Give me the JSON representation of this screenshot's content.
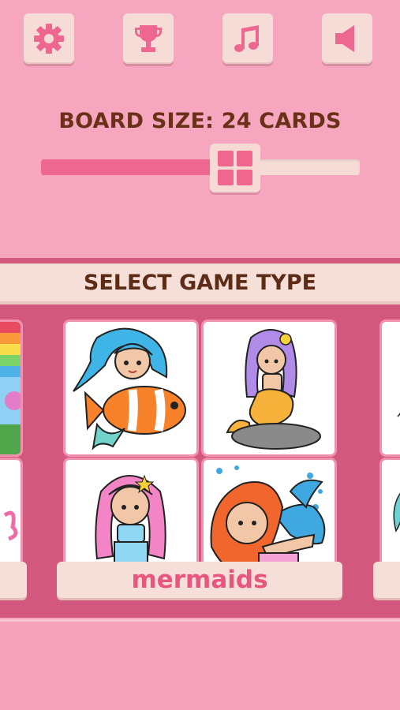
{
  "toolbar": {
    "buttons": [
      {
        "name": "settings",
        "icon": "gear-icon"
      },
      {
        "name": "achievements",
        "icon": "trophy-icon"
      },
      {
        "name": "music",
        "icon": "music-note-icon"
      },
      {
        "name": "sound",
        "icon": "speaker-icon"
      }
    ]
  },
  "board": {
    "label": "BOARD SIZE:  24  CARDS",
    "slider_fraction": 0.61
  },
  "game_type": {
    "header": "SELECT GAME TYPE",
    "selected_label": "mermaids"
  },
  "colors": {
    "background": "#f7a6c0",
    "panel": "#d2587d",
    "accent_pink": "#ee6790",
    "plate": "#f6dfd9",
    "text_brown": "#6a3118",
    "label_pink": "#e8557e"
  }
}
